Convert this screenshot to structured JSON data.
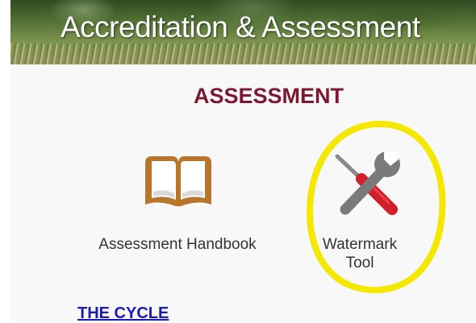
{
  "banner": {
    "title": "Accreditation & Assessment"
  },
  "section": {
    "title": "ASSESSMENT"
  },
  "tools": [
    {
      "label": "Assessment Handbook",
      "icon": "book-icon"
    },
    {
      "label": "Watermark Tool",
      "icon": "wrench-screwdriver-icon"
    }
  ],
  "links": {
    "cycle": "THE CYCLE"
  },
  "colors": {
    "section_title": "#7d1832",
    "link": "#1a1ab8",
    "highlight": "#f5e800",
    "book": "#b8762a",
    "screwdriver_handle": "#d0202a",
    "wrench": "#7a7a7a"
  }
}
